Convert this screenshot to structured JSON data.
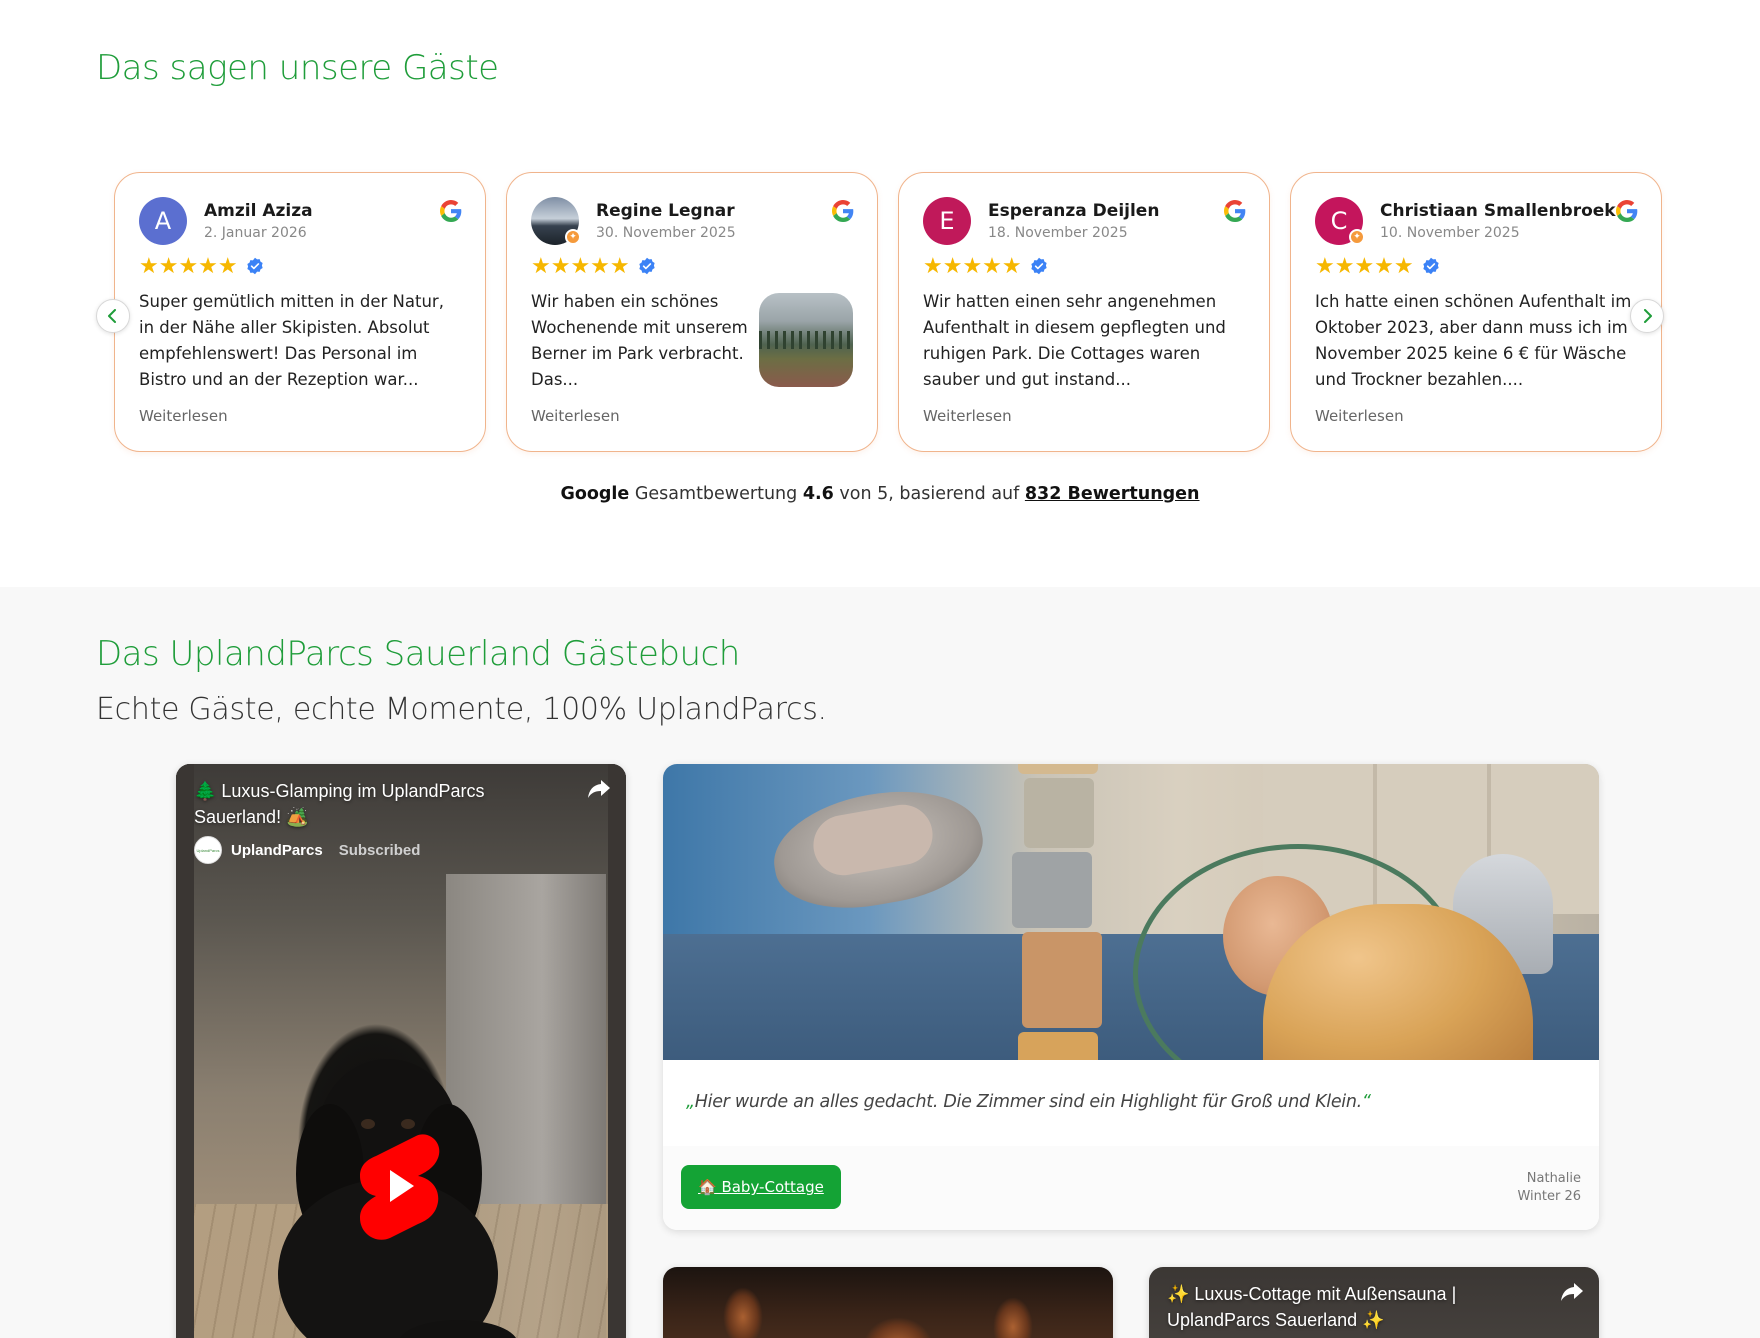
{
  "reviews": {
    "title": "Das sagen unsere Gäste",
    "cards": [
      {
        "name": "Amzil Aziza",
        "date": "2. Januar 2026",
        "avatar_letter": "A",
        "avatar_color": "#5b6fd0",
        "stars": "★★★★★",
        "text": "Super gemütlich mitten in der Natur, in der Nähe aller Skipisten. Absolut empfehlenswert! Das Personal im Bistro und an der Rezeption war...",
        "read_more": "Weiterlesen"
      },
      {
        "name": "Regine Legnar",
        "date": "30. November 2025",
        "avatar_letter": "",
        "stars": "★★★★★",
        "text": "Wir haben ein schönes Wochenende mit unserem Berner im Park verbracht. Das...",
        "read_more": "Weiterlesen"
      },
      {
        "name": "Esperanza Deijlen",
        "date": "18. November 2025",
        "avatar_letter": "E",
        "avatar_color": "#c0195a",
        "stars": "★★★★★",
        "text": "Wir hatten einen sehr angenehmen Aufenthalt in diesem gepflegten und ruhigen Park. Die Cottages waren sauber und gut instand...",
        "read_more": "Weiterlesen"
      },
      {
        "name": "Christiaan Smallenbroek",
        "date": "10. November 2025",
        "avatar_letter": "C",
        "avatar_color": "#c4155c",
        "stars": "★★★★★",
        "text": "Ich hatte einen schönen Aufenthalt im Oktober 2023, aber dann muss ich im November 2025 keine 6 € für Wäsche und Trockner bezahlen....",
        "read_more": "Weiterlesen"
      }
    ],
    "summary": {
      "brand": "Google",
      "label": "Gesamtbewertung",
      "rating": "4.6",
      "scale_text": "von 5, basierend auf",
      "count_link": "832 Bewertungen"
    }
  },
  "guestbook": {
    "title": "Das UplandParcs Sauerland Gästebuch",
    "subtitle": "Echte Gäste, echte Momente, 100% UplandParcs.",
    "main_video": {
      "title": "🌲 Luxus-Glamping im UplandParcs Sauerland! 🏕️",
      "channel": "UplandParcs",
      "subscribed": "Subscribed",
      "channel_avatar_text": "UplandParcs"
    },
    "story": {
      "quote_open": "„",
      "quote": "Hier wurde an alles gedacht. Die Zimmer sind ein Highlight für Groß und Klein.",
      "quote_close": "“",
      "tag": "🏠 Baby-Cottage",
      "author": "Nathalie",
      "season": "Winter 26"
    },
    "video_small_2": {
      "title": "✨ Luxus-Cottage mit Außensauna | UplandParcs Sauerland ✨"
    }
  },
  "colors": {
    "accent_green": "#1f9d3a",
    "card_border": "#f0b48c",
    "star": "#f6b700",
    "tag_bg": "#14a335"
  }
}
